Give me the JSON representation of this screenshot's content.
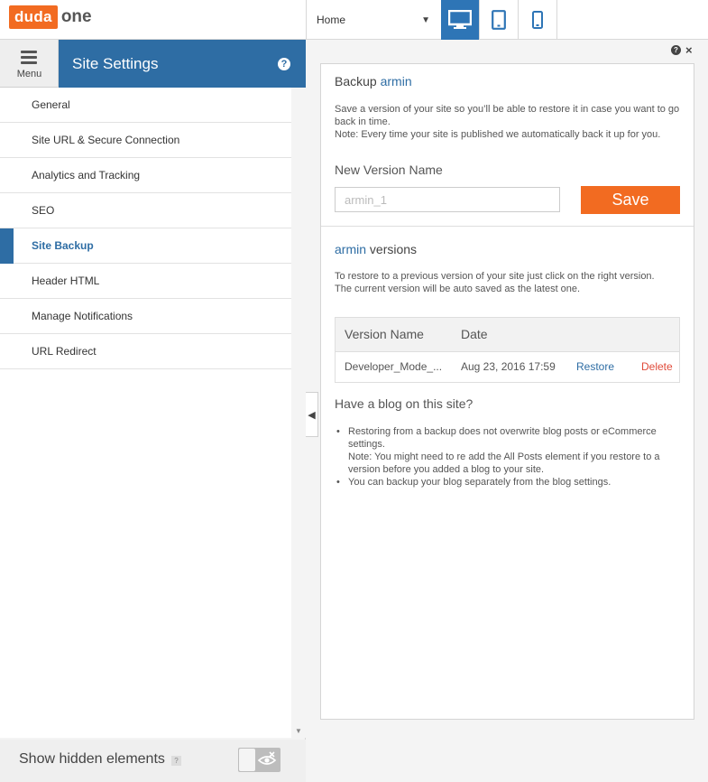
{
  "topbar": {
    "logo_box": "duda",
    "logo_text": "one",
    "page_select": "Home",
    "devices": [
      "desktop-icon",
      "tablet-icon",
      "mobile-icon"
    ]
  },
  "sidebar": {
    "menu_label": "Menu",
    "title": "Site Settings",
    "help": "?",
    "items": [
      {
        "label": "General"
      },
      {
        "label": "Site URL & Secure Connection"
      },
      {
        "label": "Analytics and Tracking"
      },
      {
        "label": "SEO"
      },
      {
        "label": "Site Backup",
        "active": true
      },
      {
        "label": "Header HTML"
      },
      {
        "label": "Manage Notifications"
      },
      {
        "label": "URL Redirect"
      }
    ],
    "footer": {
      "label": "Show hidden elements",
      "help": "?",
      "toggle_on": false
    }
  },
  "panel": {
    "help": "?",
    "close": "×",
    "backup_prefix": "Backup",
    "site_name": "armin",
    "description": "Save a version of your site so you’ll be able to restore it in case you want to go back in time.",
    "note": "Note: Every time your site is published we automatically back it up for you.",
    "new_version_label": "New Version Name",
    "new_version_placeholder": "armin_1",
    "save_label": "Save",
    "versions_suffix": "versions",
    "restore_description": "To restore to a previous version of your site just click on the right version.",
    "restore_note": "The current version will be auto saved as the latest one.",
    "table": {
      "headers": [
        "Version Name",
        "Date"
      ],
      "rows": [
        {
          "name": "Developer_Mode_...",
          "date": "Aug 23, 2016 17:59",
          "restore": "Restore",
          "delete": "Delete"
        }
      ]
    },
    "blog_heading": "Have a blog on this site?",
    "blog_bullets": [
      "Restoring from a backup does not overwrite blog posts or eCommerce settings.",
      "Note: You might need to re add the All Posts element if you restore to a version before you added a blog to your site.",
      "You can backup your blog separately from the blog settings."
    ]
  },
  "colors": {
    "accent": "#2e6da4",
    "brand_orange": "#f26b21",
    "delete_red": "#e04b3a"
  }
}
